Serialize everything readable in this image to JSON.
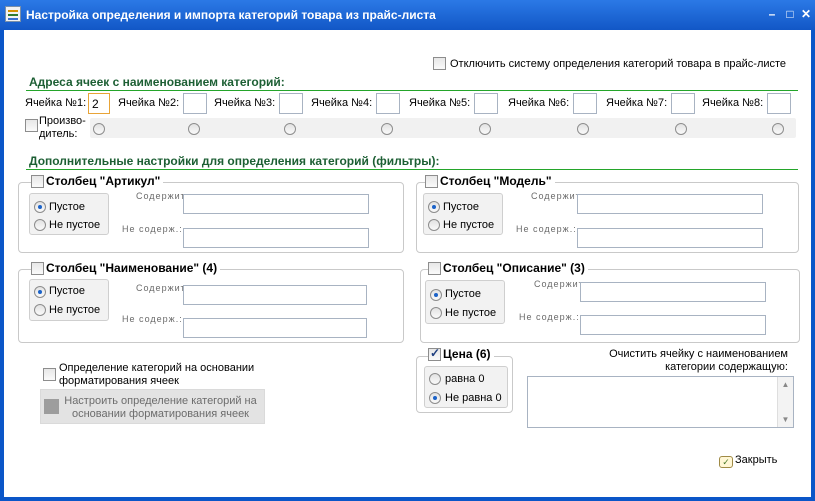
{
  "window": {
    "title": "Настройка определения и импорта категорий товара из прайс-листа"
  },
  "disable_system_label": "Отключить систему определения категорий товара в прайс-листе",
  "cells_section": {
    "title": "Адреса ячеек с наименованием категорий:",
    "cells": [
      {
        "label": "Ячейка №1:",
        "value": "2"
      },
      {
        "label": "Ячейка №2:",
        "value": ""
      },
      {
        "label": "Ячейка №3:",
        "value": ""
      },
      {
        "label": "Ячейка №4:",
        "value": ""
      },
      {
        "label": "Ячейка №5:",
        "value": ""
      },
      {
        "label": "Ячейка №6:",
        "value": ""
      },
      {
        "label": "Ячейка №7:",
        "value": ""
      },
      {
        "label": "Ячейка №8:",
        "value": ""
      }
    ],
    "manufacturer_label_1": "Произво-",
    "manufacturer_label_2": "дитель:"
  },
  "filters_section": {
    "title": "Дополнительные настройки для определения категорий (фильтры):",
    "contains_label": "Содержит:",
    "not_contains_label": "Не содерж.:",
    "empty_label": "Пустое",
    "not_empty_label": "Не пустое",
    "article": {
      "title": "Столбец \"Артикул\""
    },
    "model": {
      "title": "Столбец \"Модель\""
    },
    "name": {
      "title": "Столбец \"Наименование\" (4)"
    },
    "description": {
      "title": "Столбец \"Описание\" (3)"
    },
    "price": {
      "title": "Цена (6)",
      "eq0": "равна 0",
      "neq0": "Не равна 0"
    }
  },
  "formatting": {
    "checkbox_line1": "Определение категорий на основании",
    "checkbox_line2": "форматирования ячеек",
    "button_line1": "Настроить определение категорий на",
    "button_line2": "основании форматирования ячеек"
  },
  "clear_cell": {
    "line1": "Очистить ячейку с наименованием",
    "line2": "категории содержащую:"
  },
  "close_label": "Закрыть"
}
